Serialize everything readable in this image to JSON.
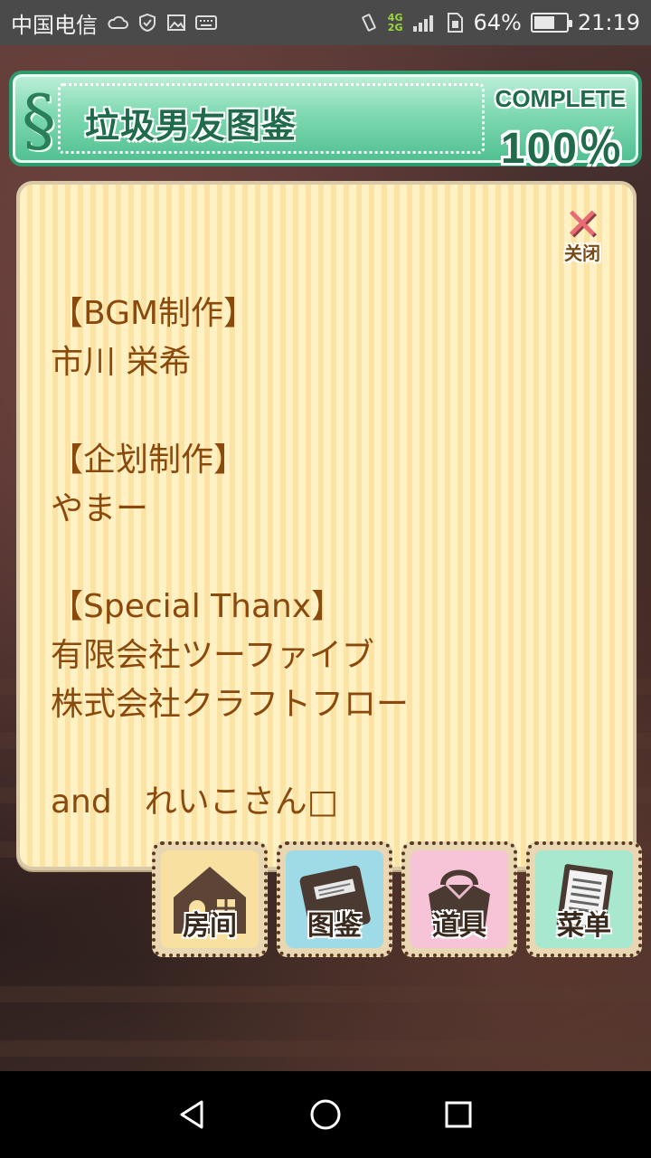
{
  "status_bar": {
    "carrier": "中国电信",
    "network_top": "4G",
    "network_bottom": "2G",
    "battery_percent": "64%",
    "battery_level": 0.64,
    "time": "21:19"
  },
  "header": {
    "title": "垃圾男友图鉴",
    "section_icon": "§",
    "complete_label": "COMPLETE",
    "complete_percent": "100％"
  },
  "panel": {
    "close_label": "关闭",
    "credits": [
      "【BGM制作】",
      "市川 栄希",
      "",
      "【企划制作】",
      "やまー",
      "",
      "【Special Thanx】",
      "有限会社ツーファイブ",
      "株式会社クラフトフロー",
      "",
      "and　れいこさん□"
    ]
  },
  "menu": {
    "buttons": [
      {
        "label": "房间",
        "icon": "house-icon",
        "color": "#f7e0a0"
      },
      {
        "label": "图鉴",
        "icon": "book-icon",
        "color": "#9fdbe7"
      },
      {
        "label": "道具",
        "icon": "bag-icon",
        "color": "#f7c3d6"
      },
      {
        "label": "菜单",
        "icon": "list-icon",
        "color": "#a8e8cf"
      }
    ]
  },
  "nav": {
    "back": "back-icon",
    "home": "home-icon",
    "recents": "recents-icon"
  }
}
